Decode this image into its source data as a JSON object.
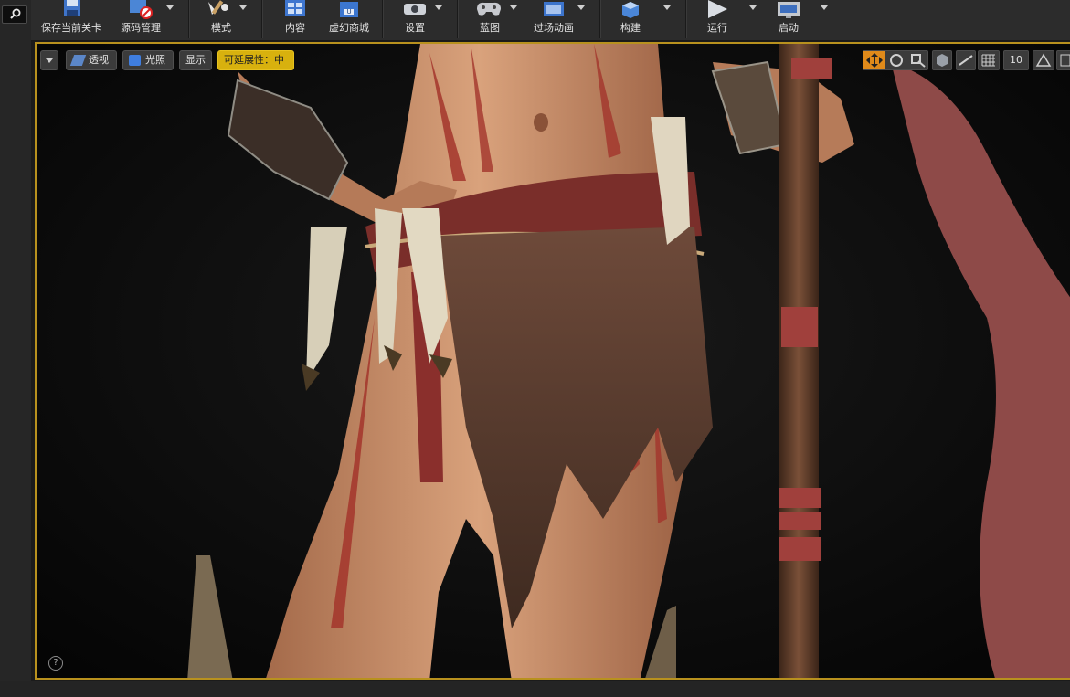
{
  "toolbar": {
    "items": [
      {
        "label": "保存当前关卡",
        "icon": "floppy-disk-icon"
      },
      {
        "label": "源码管理",
        "icon": "source-control-icon"
      },
      {
        "label": "模式",
        "icon": "modes-brush-icon"
      },
      {
        "label": "内容",
        "icon": "content-grid-icon"
      },
      {
        "label": "虚幻商城",
        "icon": "marketplace-bag-icon"
      },
      {
        "label": "设置",
        "icon": "settings-gear-icon"
      },
      {
        "label": "蓝图",
        "icon": "blueprint-gamepad-icon"
      },
      {
        "label": "过场动画",
        "icon": "cinematics-clapper-icon"
      },
      {
        "label": "构建",
        "icon": "build-cubes-icon"
      },
      {
        "label": "运行",
        "icon": "play-icon"
      },
      {
        "label": "启动",
        "icon": "launch-monitor-icon"
      }
    ]
  },
  "viewport": {
    "perspective_label": "透视",
    "lit_label": "光照",
    "show_label": "显示",
    "scalability_label": "可延展性：中",
    "grid_snap_value": "10",
    "help_glyph": "?"
  },
  "colors": {
    "accent_border": "#b8911e",
    "scalability_bg": "#d8b10e",
    "transform_active": "#e08a1a"
  }
}
